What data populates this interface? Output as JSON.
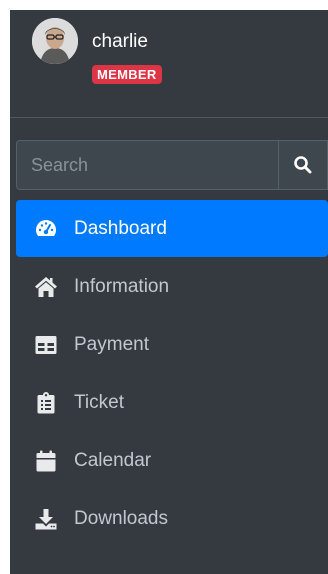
{
  "user": {
    "name": "charlie",
    "role_badge": "MEMBER"
  },
  "search": {
    "placeholder": "Search",
    "value": ""
  },
  "nav": {
    "items": [
      {
        "label": "Dashboard",
        "icon": "tachometer-icon",
        "active": true
      },
      {
        "label": "Information",
        "icon": "home-icon",
        "active": false
      },
      {
        "label": "Payment",
        "icon": "table-icon",
        "active": false
      },
      {
        "label": "Ticket",
        "icon": "clipboard-icon",
        "active": false
      },
      {
        "label": "Calendar",
        "icon": "calendar-icon",
        "active": false
      },
      {
        "label": "Downloads",
        "icon": "download-icon",
        "active": false
      }
    ]
  },
  "colors": {
    "sidebar_bg": "#343a40",
    "active_bg": "#007bff",
    "badge_bg": "#dc3545",
    "text_muted": "#c2c7d0"
  }
}
